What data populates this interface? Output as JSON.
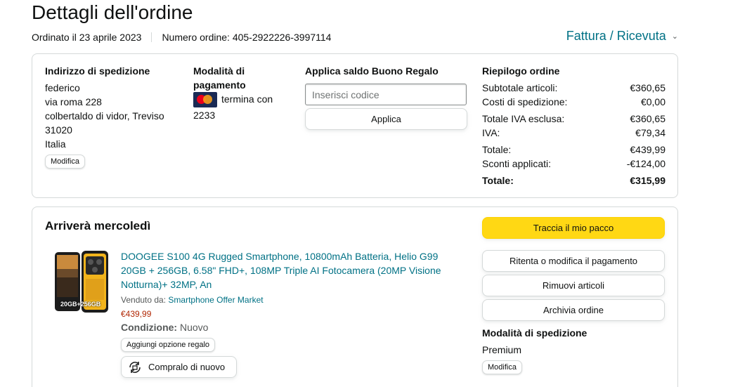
{
  "header": {
    "title": "Dettagli dell'ordine",
    "ordered_on": "Ordinato il 23 aprile 2023",
    "order_number": "Numero ordine: 405-2922226-3997114",
    "invoice_link": "Fattura / Ricevuta"
  },
  "shipping_address": {
    "heading": "Indirizzo di spedizione",
    "name": "federico",
    "street": "via roma 228",
    "city": "colbertaldo di vidor, Treviso",
    "zip": "31020",
    "country": "Italia",
    "edit_label": "Modifica"
  },
  "payment": {
    "heading_line1": "Modalità di",
    "heading_line2": "pagamento",
    "card_text": "termina con",
    "card_last4": "2233",
    "card_icon": "mastercard-icon"
  },
  "gift": {
    "heading": "Applica saldo Buono Regalo",
    "placeholder": "Inserisci codice",
    "apply_label": "Applica"
  },
  "summary": {
    "heading": "Riepilogo ordine",
    "rows": [
      {
        "label": "Subtotale articoli:",
        "value": "€360,65"
      },
      {
        "label": "Costi di spedizione:",
        "value": "€0,00"
      },
      {
        "label": "Totale IVA esclusa:",
        "value": "€360,65"
      },
      {
        "label": "IVA:",
        "value": "€79,34"
      },
      {
        "label": "Totale:",
        "value": "€439,99"
      },
      {
        "label": "Sconti applicati:",
        "value": "-€124,00"
      },
      {
        "label": "Totale:",
        "value": "€315,99"
      }
    ]
  },
  "shipment": {
    "arrival": "Arriverà mercoledì",
    "product": {
      "title_line1": "DOOGEE S100 4G Rugged Smartphone, 10800mAh Batteria, Helio G99",
      "title_line2": "20GB + 256GB, 6.58\" FHD+, 108MP Triple AI Fotocamera (20MP Visione",
      "title_line3": "Notturna)+ 32MP, An",
      "sold_by_label": "Venduto da:",
      "seller": "Smartphone Offer Market",
      "price": "€439,99",
      "condition_label": "Condizione:",
      "condition": "Nuovo",
      "gift_option_label": "Aggiungi opzione regalo",
      "buy_again_label": "Compralo di nuovo",
      "image_badge": "20GB+256GB"
    },
    "actions": {
      "track": "Traccia il mio pacco",
      "retry_payment": "Ritenta o modifica il pagamento",
      "remove_items": "Rimuovi articoli",
      "archive": "Archivia ordine"
    },
    "shipping_method": {
      "heading": "Modalità di spedizione",
      "value": "Premium",
      "edit_label": "Modifica"
    }
  },
  "colors": {
    "link": "#007185",
    "price": "#b12704",
    "primary_button": "#ffd814",
    "border": "#d5d9d9"
  }
}
